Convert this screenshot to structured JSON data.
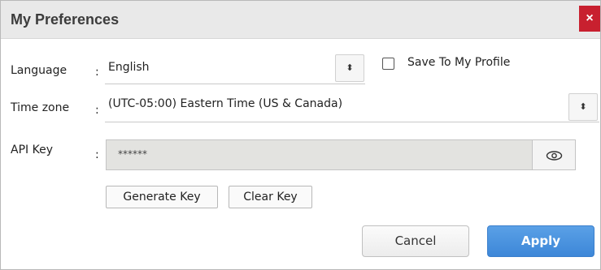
{
  "dialog": {
    "title": "My Preferences",
    "close_glyph": "×"
  },
  "language": {
    "label": "Language",
    "colon": ":",
    "value": "English",
    "spinner_icon": "updown-arrows-icon",
    "spinner_glyph": "⬍"
  },
  "save_profile": {
    "label": "Save To My Profile",
    "checked": false
  },
  "timezone": {
    "label": "Time zone",
    "colon": ":",
    "value": "(UTC-05:00) Eastern Time (US & Canada)",
    "spinner_glyph": "⬍"
  },
  "api_key": {
    "label": "API Key",
    "colon": ":",
    "value": "******",
    "reveal_icon": "eye-icon",
    "generate_label": "Generate Key",
    "clear_label": "Clear Key"
  },
  "footer": {
    "cancel_label": "Cancel",
    "apply_label": "Apply"
  },
  "colors": {
    "titlebar": "#e9e9e9",
    "close": "#c8202f",
    "apply": "#4a90e2",
    "api_field_bg": "#e3e3e0"
  }
}
